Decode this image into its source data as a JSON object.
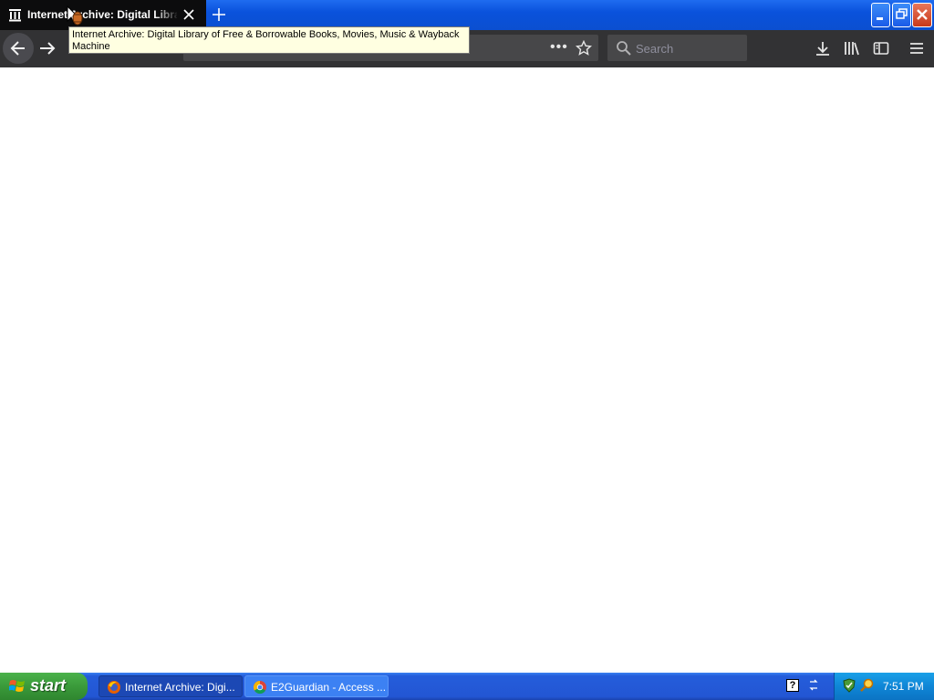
{
  "browser": {
    "tab": {
      "title": "Internet Archive: Digital Library of Free & Borrowable Books, Movies, Music & Wayback Machine",
      "favicon": "archive-building-icon"
    },
    "tooltip": "Internet Archive: Digital Library of Free & Borrowable Books, Movies, Music & Wayback Machine",
    "search_placeholder": "Search",
    "url_actions_label": "•••"
  },
  "taskbar": {
    "start_label": "start",
    "tasks": [
      {
        "label": "Internet Archive: Digi...",
        "icon": "firefox-icon",
        "active": true
      },
      {
        "label": "E2Guardian - Access ...",
        "icon": "chrome-icon",
        "active": false
      }
    ],
    "clock": "7:51 PM"
  },
  "colors": {
    "tab_bg": "#0c0c0d",
    "toolbar_bg": "#323234",
    "xp_blue": "#245ddb",
    "start_green": "#3a9a3a",
    "tray_blue": "#0f86d6"
  }
}
